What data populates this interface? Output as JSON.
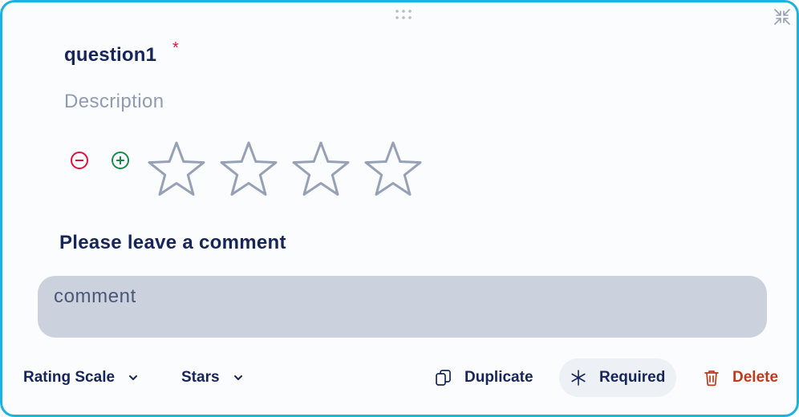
{
  "question": {
    "title": "question1",
    "required_marker": "*",
    "description_placeholder": "Description"
  },
  "rating": {
    "star_count": 4,
    "selected": 0,
    "decrease_icon": "minus-circle-icon",
    "increase_icon": "plus-circle-icon"
  },
  "comment": {
    "label": "Please leave a comment",
    "placeholder": "comment"
  },
  "toolbar": {
    "type_label": "Rating Scale",
    "display_label": "Stars",
    "duplicate_label": "Duplicate",
    "required_label": "Required",
    "delete_label": "Delete"
  },
  "colors": {
    "accent_border": "#19b3e0",
    "title_text": "#16255a",
    "required_star": "#e5103e",
    "decrease": "#e5103e",
    "increase": "#1b8a4a",
    "delete": "#bf3a1c",
    "star_outline": "#96a0b6"
  }
}
